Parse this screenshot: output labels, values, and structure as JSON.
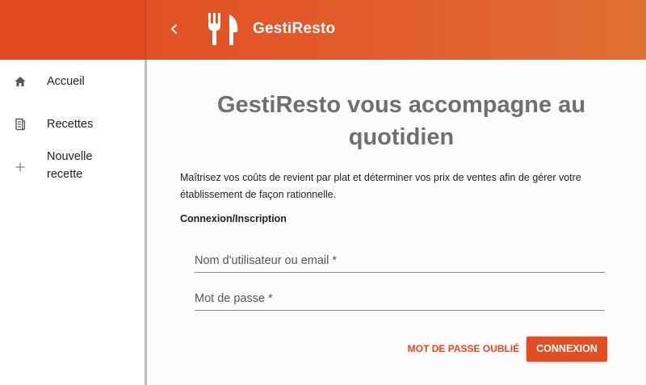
{
  "header": {
    "back_icon": "chevron-left-icon",
    "logo_icon": "fork-knife-icon",
    "title": "GestiResto"
  },
  "sidebar": {
    "items": [
      {
        "icon": "home-icon",
        "label": "Accueil"
      },
      {
        "icon": "receipt-icon",
        "label": "Recettes"
      },
      {
        "icon": "plus-icon",
        "label": "Nouvelle recette"
      }
    ]
  },
  "main": {
    "headline": "GestiResto vous accompagne au quotidien",
    "intro": "Maîtrisez vos coûts de revient par plat et déterminer vos prix de ventes afin de gérer votre établissement de façon rationnelle.",
    "section_label": "Connexion/Inscription",
    "form": {
      "username_placeholder": "Nom d'utilisateur ou email *",
      "password_placeholder": "Mot de passe *",
      "forgot_label": "MOT DE PASSE OUBLIÉ",
      "submit_label": "CONNEXION"
    }
  },
  "colors": {
    "accent": "#e14e24",
    "header_gradient_start": "#e04a22",
    "header_gradient_end": "#e06f33"
  }
}
